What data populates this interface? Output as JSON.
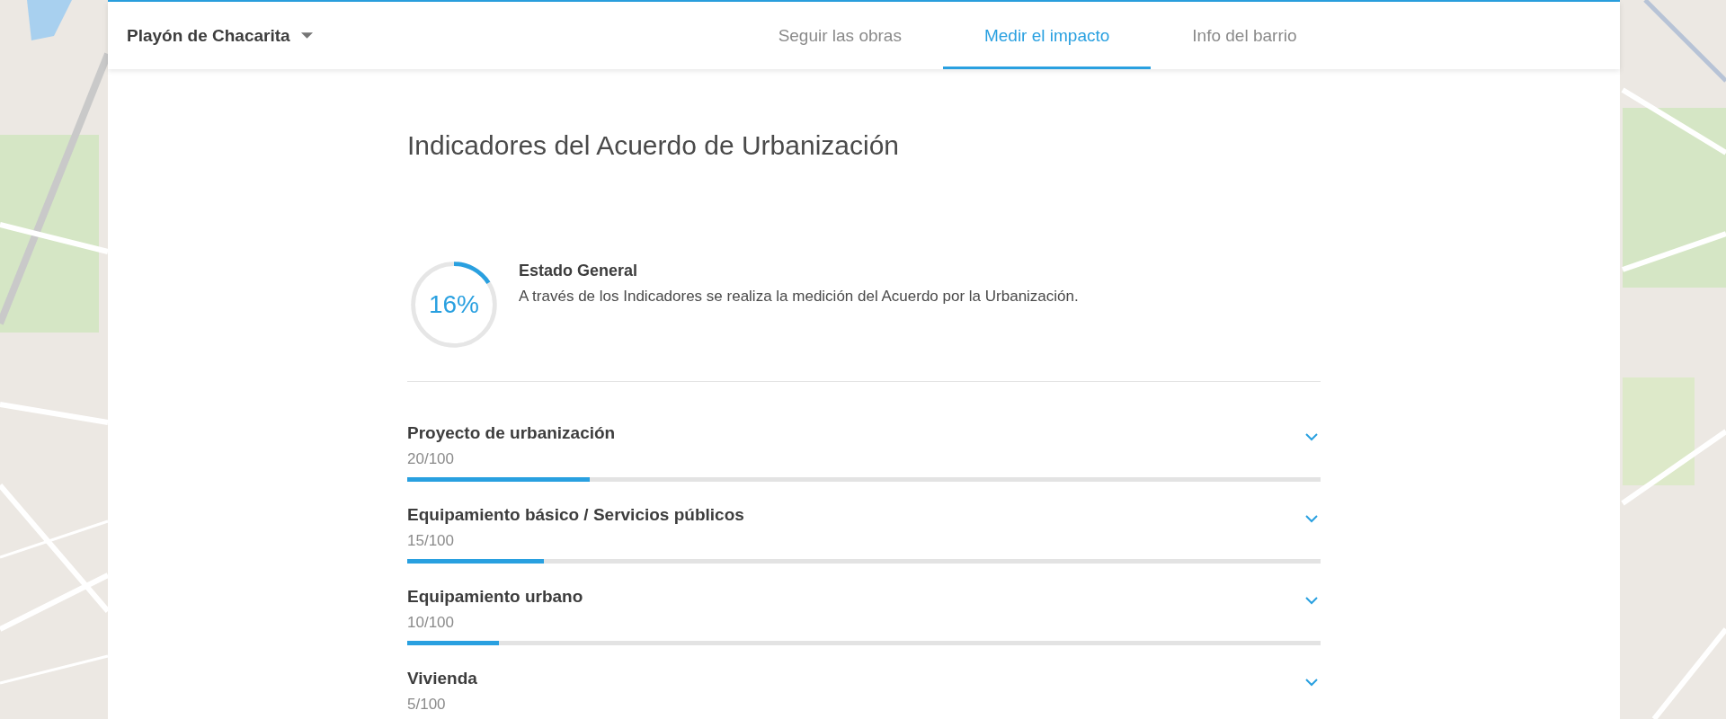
{
  "header": {
    "neighborhood": "Playón de Chacarita",
    "tabs": [
      {
        "label": "Seguir las obras",
        "selected": false
      },
      {
        "label": "Medir el impacto",
        "selected": true
      },
      {
        "label": "Info del barrio",
        "selected": false
      }
    ]
  },
  "title": "Indicadores del Acuerdo de Urbanización",
  "general": {
    "title": "Estado General",
    "percent": "16%",
    "level": 0.16,
    "description": "A través de los Indicadores se realiza la medición del Acuerdo por la Urbanización."
  },
  "indicators": [
    {
      "name": "Proyecto de urbanización",
      "score": "20/100",
      "level": 0.2,
      "expanded": false
    },
    {
      "name": "Equipamiento básico / Servicios públicos",
      "score": "15/100",
      "level": 0.15,
      "expanded": false
    },
    {
      "name": "Equipamiento urbano",
      "score": "10/100",
      "level": 0.1,
      "expanded": false
    },
    {
      "name": "Vivienda",
      "score": "5/100",
      "expanded": false
    }
  ]
}
